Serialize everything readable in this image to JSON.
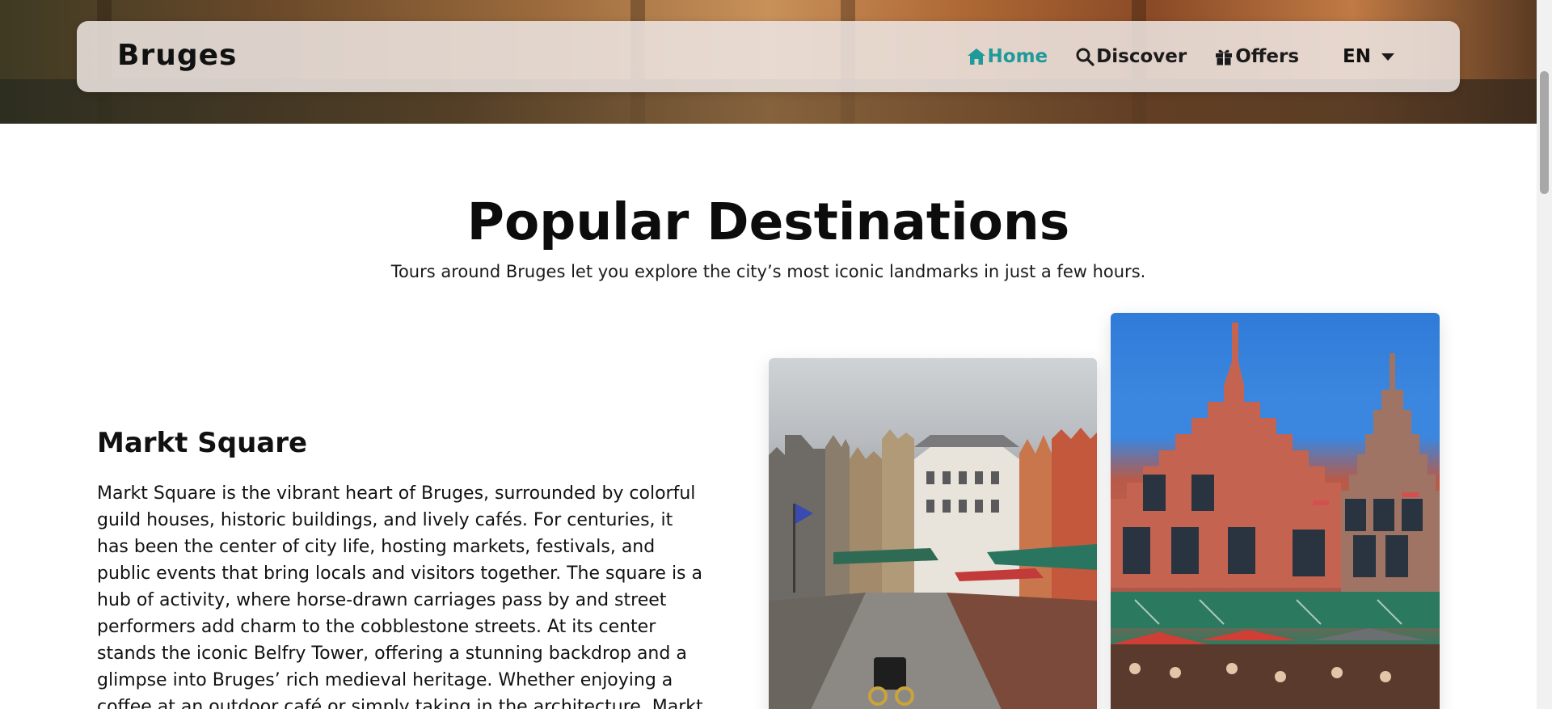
{
  "navbar": {
    "brand": "Bruges",
    "links": [
      {
        "label": "Home",
        "icon": "home-icon",
        "active": true
      },
      {
        "label": "Discover",
        "icon": "search-icon",
        "active": false
      },
      {
        "label": "Offers",
        "icon": "gift-icon",
        "active": false
      }
    ],
    "language": "EN"
  },
  "section": {
    "title": "Popular Destinations",
    "subtitle": "Tours around Bruges let you explore the city’s most iconic landmarks in just a few hours."
  },
  "destination": {
    "title": "Markt Square",
    "description": "Markt Square is the vibrant heart of Bruges, surrounded by colorful guild houses, historic buildings, and lively cafés. For centuries, it has been the center of city life, hosting markets, festivals, and public events that bring locals and visitors together. The square is a hub of activity, where horse-drawn carriages pass by and street performers add charm to the cobblestone streets. At its center stands the iconic Belfry Tower, offering a stunning backdrop and a glimpse into Bruges’ rich medieval heritage. Whether enjoying a coffee at an outdoor café or simply taking in the architecture, Markt"
  },
  "colors": {
    "accent": "#1f9a9a",
    "text": "#111111",
    "navbar_bg": "#ece4e0"
  }
}
